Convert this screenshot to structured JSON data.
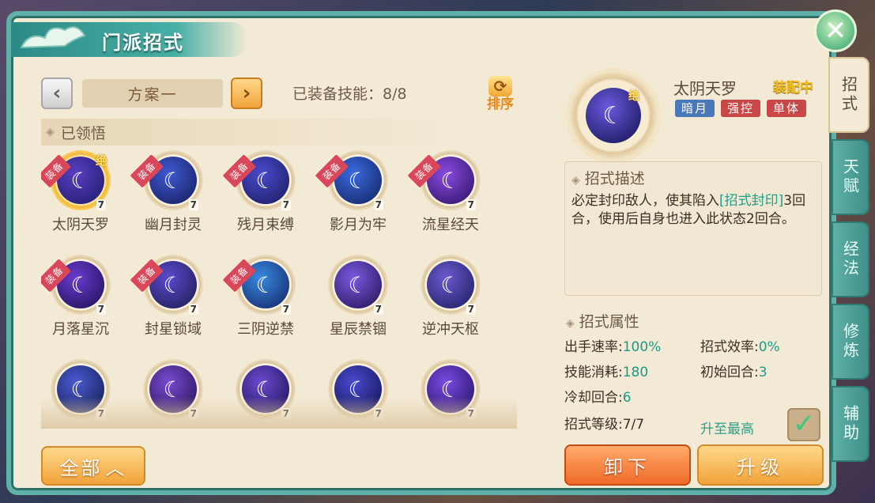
{
  "window": {
    "title": "门派招式",
    "close_icon": "close-icon"
  },
  "toolbar": {
    "scheme_label": "方案一",
    "equipped_label": "已装备技能：8/8",
    "sort_label": "排序"
  },
  "section": {
    "learned_label": "已领悟"
  },
  "skills": [
    {
      "name": "太阴天罗",
      "badge": "装备",
      "level": "7",
      "ultimate": "绝",
      "gradient": "#5a3fc0,#1a1a6a"
    },
    {
      "name": "幽月封灵",
      "badge": "装备",
      "level": "7",
      "ultimate": "",
      "gradient": "#3f5ad0,#141a5a"
    },
    {
      "name": "残月束缚",
      "badge": "装备",
      "level": "7",
      "ultimate": "",
      "gradient": "#4a4ad0,#1a1a5a"
    },
    {
      "name": "影月为牢",
      "badge": "装备",
      "level": "7",
      "ultimate": "",
      "gradient": "#3a6ae0,#10205a"
    },
    {
      "name": "流星经天",
      "badge": "装备",
      "level": "7",
      "ultimate": "",
      "gradient": "#8a4ae0,#2a1060"
    },
    {
      "name": "月落星沉",
      "badge": "装备",
      "level": "7",
      "ultimate": "",
      "gradient": "#6a3ad0,#1a1050"
    },
    {
      "name": "封星锁域",
      "badge": "装备",
      "level": "7",
      "ultimate": "",
      "gradient": "#5a4ad0,#1a1a4a"
    },
    {
      "name": "三阴逆禁",
      "badge": "装备",
      "level": "7",
      "ultimate": "",
      "gradient": "#3a8ae0,#102060"
    },
    {
      "name": "星辰禁锢",
      "badge": "",
      "level": "7",
      "ultimate": "",
      "gradient": "#7a5ae0,#201050"
    },
    {
      "name": "逆冲天枢",
      "badge": "",
      "level": "7",
      "ultimate": "",
      "gradient": "#6a5ad0,#1a1a5a"
    },
    {
      "name": "",
      "badge": "",
      "level": "7",
      "ultimate": "",
      "gradient": "#4a5ad0,#101a4a"
    },
    {
      "name": "",
      "badge": "",
      "level": "7",
      "ultimate": "",
      "gradient": "#7a4ad0,#201050"
    },
    {
      "name": "",
      "badge": "",
      "level": "7",
      "ultimate": "",
      "gradient": "#6a4ad0,#1a1050"
    },
    {
      "name": "",
      "badge": "",
      "level": "7",
      "ultimate": "",
      "gradient": "#4a4ad0,#10104a"
    },
    {
      "name": "",
      "badge": "",
      "level": "7",
      "ultimate": "",
      "gradient": "#7a4ae0,#201060"
    }
  ],
  "all_button": "全部",
  "detail": {
    "name": "太阴天罗",
    "status": "装配中",
    "ultimate": "绝",
    "tags": [
      {
        "label": "暗月",
        "color": "#4a78b8"
      },
      {
        "label": "强控",
        "color": "#c84848"
      },
      {
        "label": "单体",
        "color": "#c84848"
      }
    ],
    "desc_title": "招式描述",
    "desc_part1": "必定封印敌人，使其陷入",
    "desc_highlight": "[招式封印]",
    "desc_part2": "3回合，使用后自身也进入此状态2回合。",
    "attr_title": "招式属性",
    "attrs": {
      "speed_label": "出手速率:",
      "speed_value": "100%",
      "effect_label": "招式效率:",
      "effect_value": "0%",
      "cost_label": "技能消耗:",
      "cost_value": "180",
      "init_label": "初始回合:",
      "init_value": "3",
      "cooldown_label": "冷却回合:",
      "cooldown_value": "6",
      "level_label": "招式等级:",
      "level_value": "7/7"
    },
    "max_label": "升至最高",
    "max_checked": true,
    "unload_label": "卸下",
    "upgrade_label": "升级"
  },
  "side_tabs": [
    {
      "label": "招式",
      "active": true
    },
    {
      "label": "天赋",
      "active": false
    },
    {
      "label": "经法",
      "active": false
    },
    {
      "label": "修炼",
      "active": false
    },
    {
      "label": "辅助",
      "active": false
    }
  ]
}
